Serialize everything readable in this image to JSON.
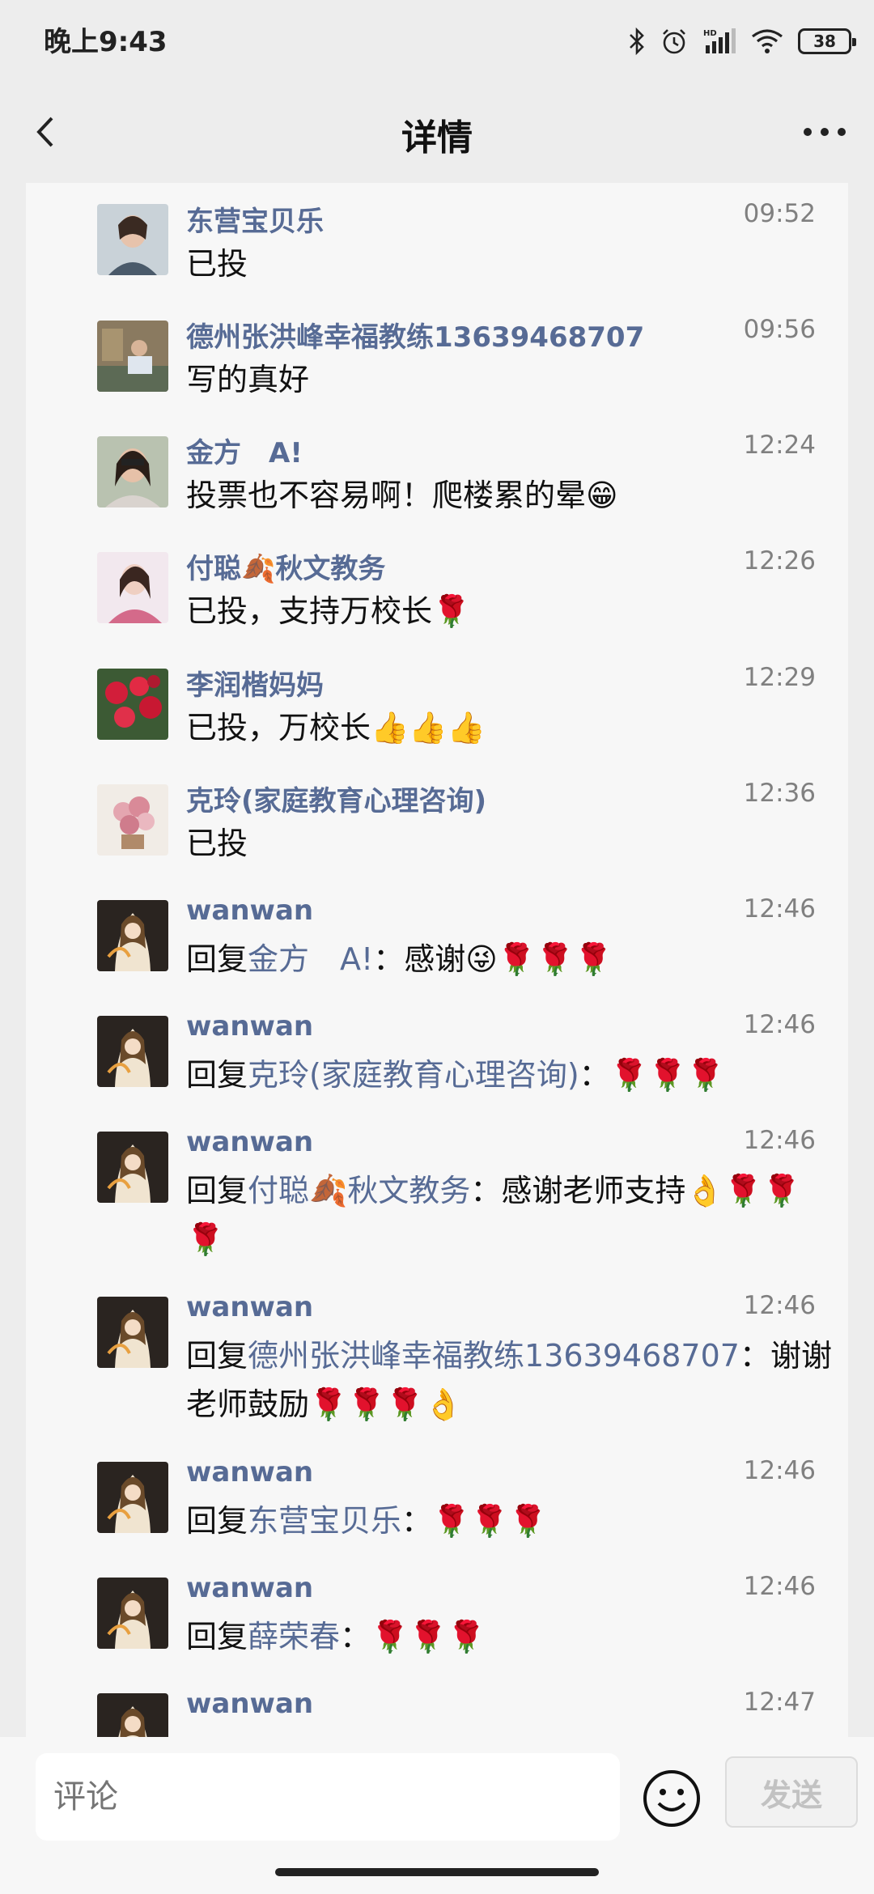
{
  "status_bar": {
    "time": "晚上9:43",
    "battery": "38",
    "icons": [
      "bluetooth-icon",
      "alarm-icon",
      "hd-signal-icon",
      "wifi-icon",
      "battery-icon"
    ]
  },
  "nav": {
    "title": "详情",
    "icons": [
      "back-icon",
      "more-icon"
    ]
  },
  "comments": [
    {
      "name": "东营宝贝乐",
      "time": "09:52",
      "text": "已投"
    },
    {
      "name": "德州张洪峰幸福教练13639468707",
      "time": "09:56",
      "text": "写的真好"
    },
    {
      "name": "金方　A!",
      "time": "12:24",
      "text": "投票也不容易啊！爬楼累的晕😁"
    },
    {
      "name": "付聪🍂秋文教务",
      "time": "12:26",
      "text": "已投，支持万校长🌹"
    },
    {
      "name": "李润楷妈妈",
      "time": "12:29",
      "text": "已投，万校长👍👍👍"
    },
    {
      "name": "克玲(家庭教育心理咨询)",
      "time": "12:36",
      "text": "已投"
    },
    {
      "name": "wanwan",
      "time": "12:46",
      "reply_prefix": "回复",
      "reply_to": "金方　A!",
      "text": "：感谢😜🌹🌹🌹"
    },
    {
      "name": "wanwan",
      "time": "12:46",
      "reply_prefix": "回复",
      "reply_to": "克玲(家庭教育心理咨询)",
      "text": "：🌹🌹🌹"
    },
    {
      "name": "wanwan",
      "time": "12:46",
      "reply_prefix": "回复",
      "reply_to": "付聪🍂秋文教务",
      "text": "：感谢老师支持👌🌹🌹🌹"
    },
    {
      "name": "wanwan",
      "time": "12:46",
      "reply_prefix": "回复",
      "reply_to": "德州张洪峰幸福教练13639468707",
      "text": "：谢谢老师鼓励🌹🌹🌹👌"
    },
    {
      "name": "wanwan",
      "time": "12:46",
      "reply_prefix": "回复",
      "reply_to": "东营宝贝乐",
      "text": "：🌹🌹🌹"
    },
    {
      "name": "wanwan",
      "time": "12:46",
      "reply_prefix": "回复",
      "reply_to": "薛荣春",
      "text": "：🌹🌹🌹"
    },
    {
      "name": "wanwan",
      "time": "12:47",
      "text": ""
    }
  ],
  "input_bar": {
    "placeholder": "评论",
    "send_label": "发送",
    "icons": [
      "emoji-icon"
    ]
  },
  "colors": {
    "link": "#576b95",
    "background": "#ededed",
    "panel": "#f7f7f7"
  }
}
